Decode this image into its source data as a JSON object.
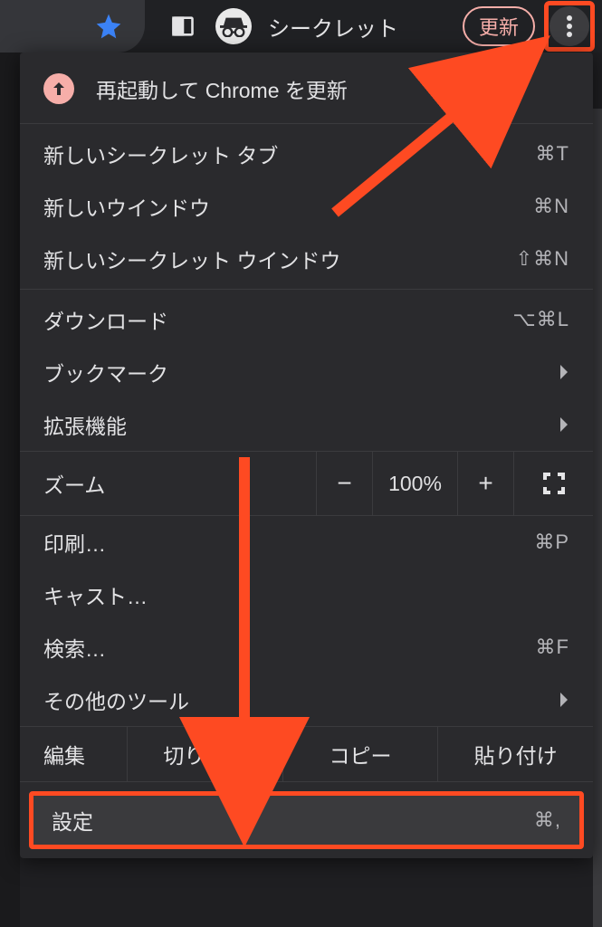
{
  "toolbar": {
    "incognito_label": "シークレット",
    "update_pill": "更新"
  },
  "menu": {
    "update_row": "再起動して Chrome を更新",
    "new_incog_tab": {
      "label": "新しいシークレット タブ",
      "shortcut": "⌘T"
    },
    "new_window": {
      "label": "新しいウインドウ",
      "shortcut": "⌘N"
    },
    "new_incog_window": {
      "label": "新しいシークレット ウインドウ",
      "shortcut": "⇧⌘N"
    },
    "downloads": {
      "label": "ダウンロード",
      "shortcut": "⌥⌘L"
    },
    "bookmarks": {
      "label": "ブックマーク"
    },
    "extensions": {
      "label": "拡張機能"
    },
    "zoom": {
      "label": "ズーム",
      "minus": "−",
      "value": "100%",
      "plus": "+"
    },
    "print": {
      "label": "印刷…",
      "shortcut": "⌘P"
    },
    "cast": {
      "label": "キャスト…"
    },
    "find": {
      "label": "検索…",
      "shortcut": "⌘F"
    },
    "more_tools": {
      "label": "その他のツール"
    },
    "edit": {
      "label": "編集",
      "cut": "切り取り",
      "copy": "コピー",
      "paste": "貼り付け"
    },
    "settings": {
      "label": "設定",
      "shortcut": "⌘,"
    }
  }
}
